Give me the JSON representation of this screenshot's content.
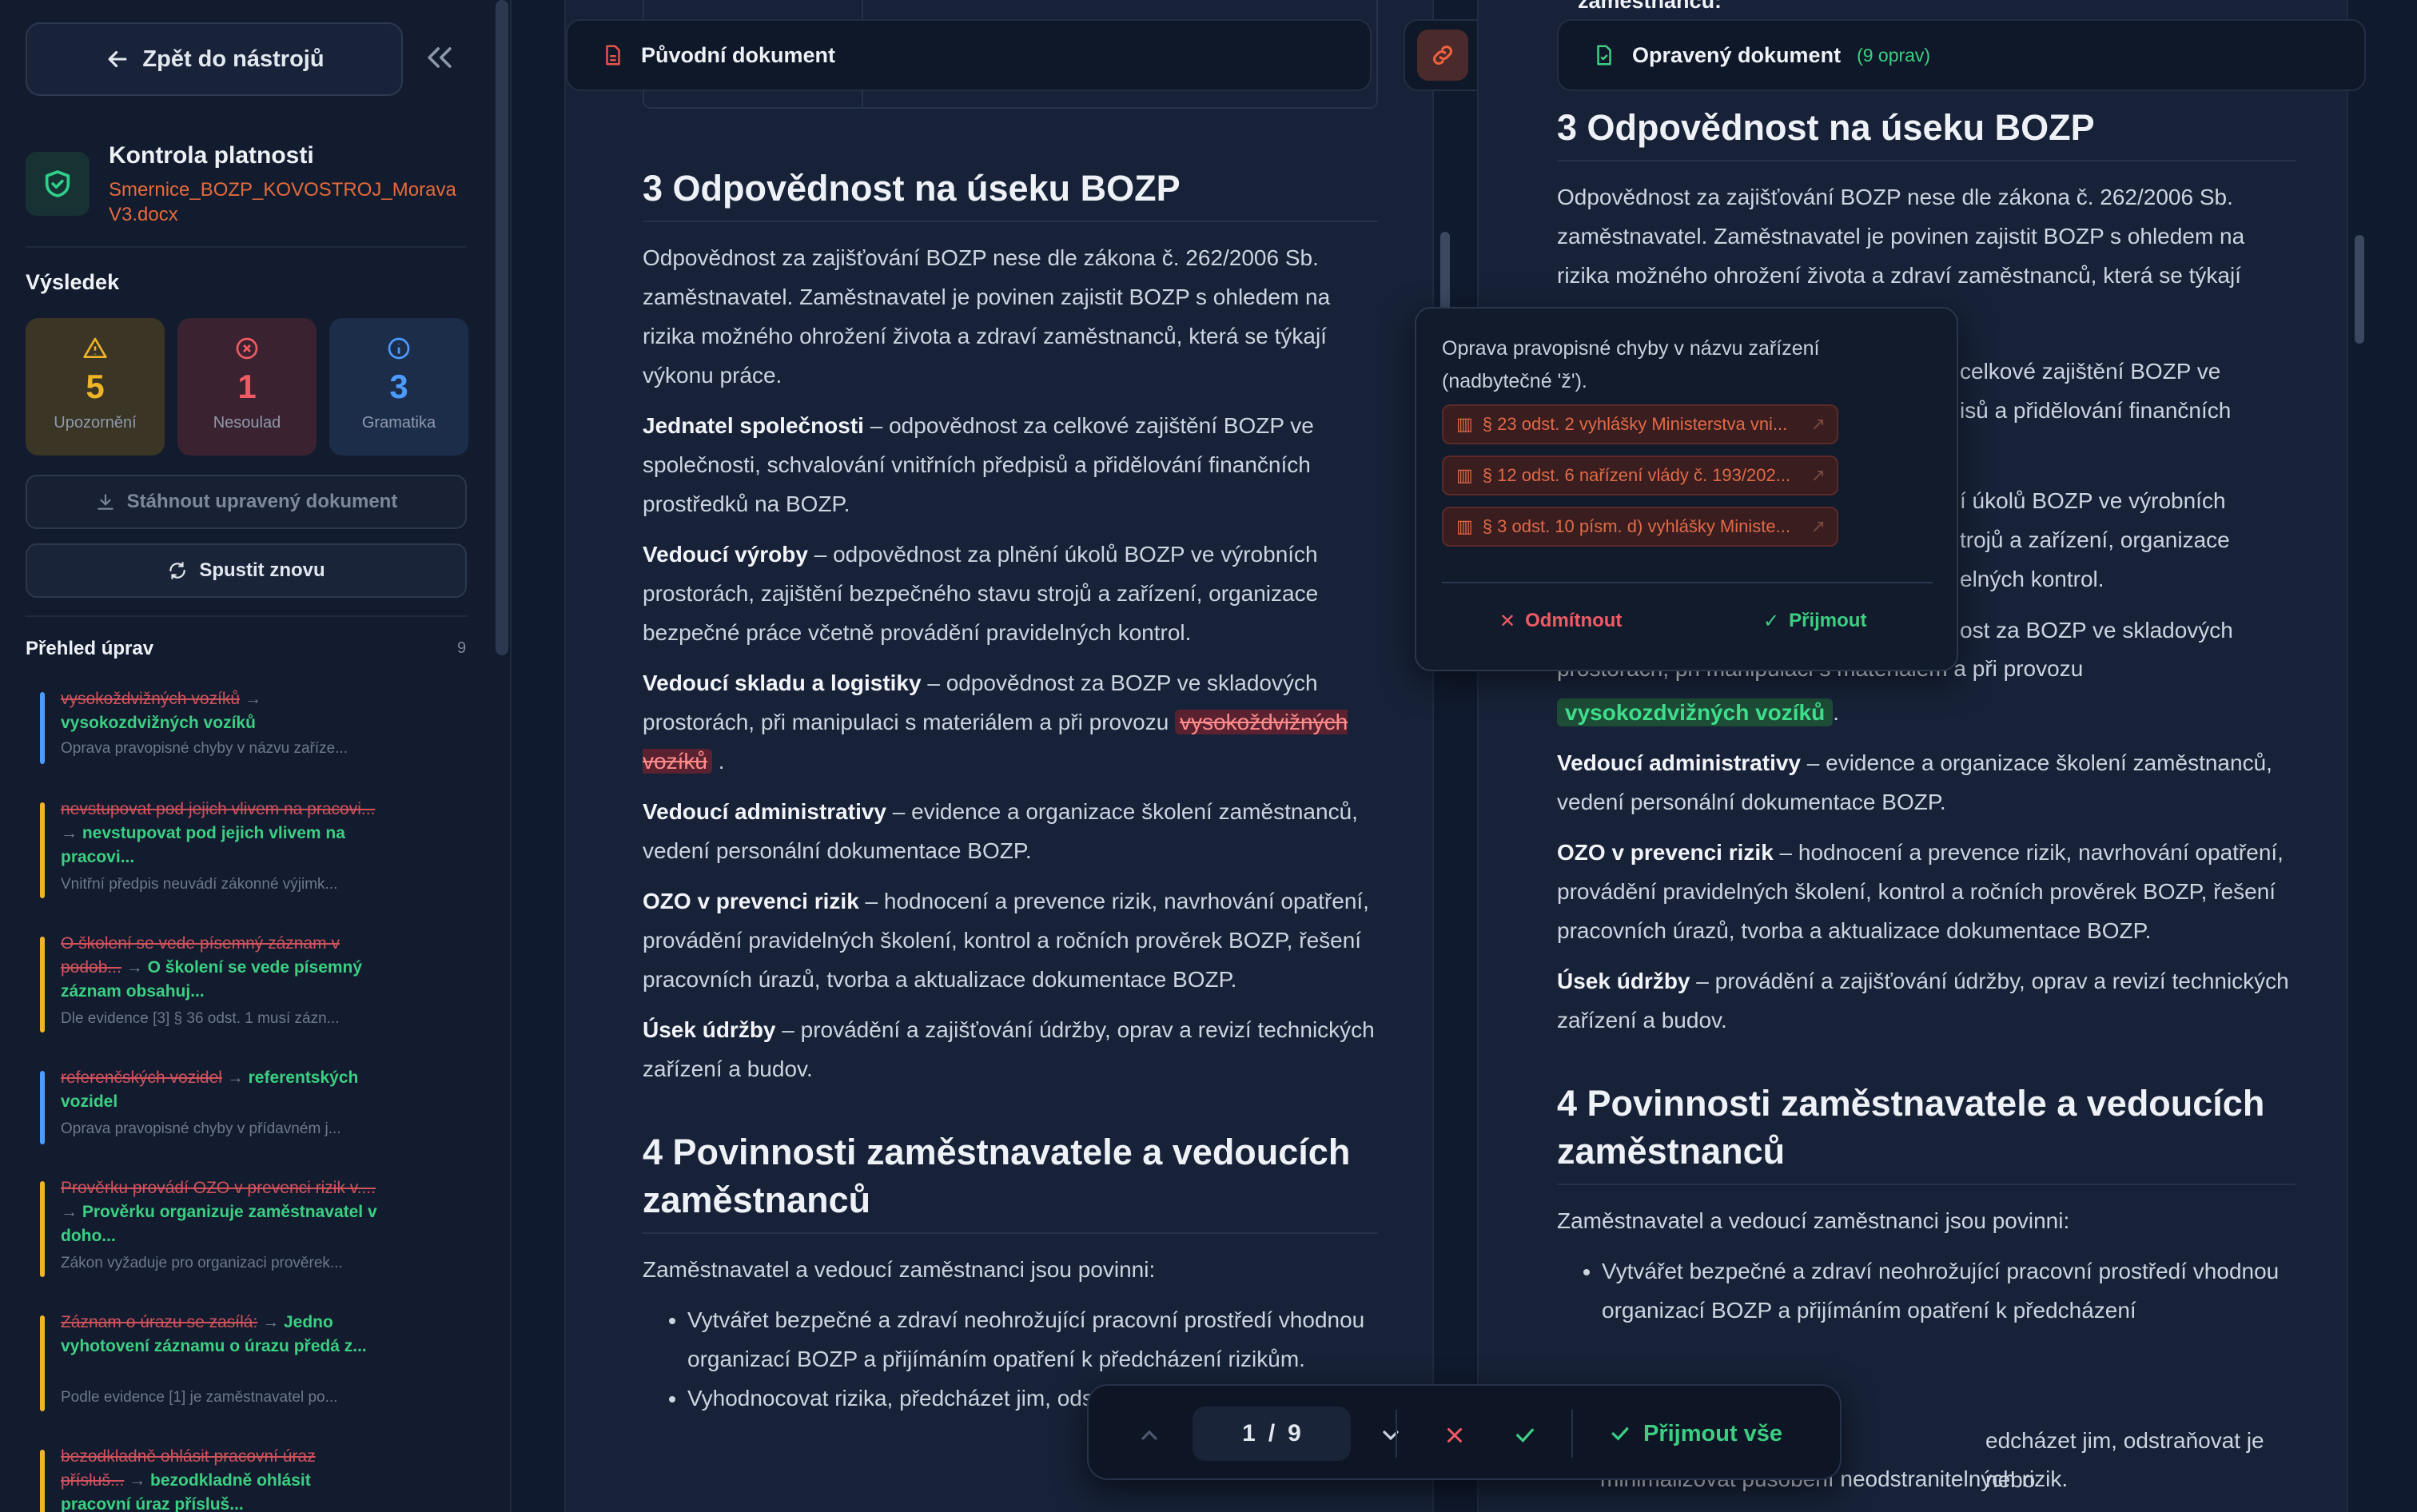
{
  "sidebar": {
    "back_label": "Zpět do nástrojů",
    "title": "Kontrola platnosti",
    "filename": "Smernice_BOZP_KOVOSTROJ_Morava V3.docx",
    "result_heading": "Výsledek",
    "stats": [
      {
        "value": "5",
        "label": "Upozornění",
        "color": "#f0b429"
      },
      {
        "value": "1",
        "label": "Nesoulad",
        "color": "#ef5b65"
      },
      {
        "value": "3",
        "label": "Gramatika",
        "color": "#4c9bff"
      }
    ],
    "download_label": "Stáhnout upravený dokument",
    "rerun_label": "Spustit znovu",
    "overview_heading": "Přehled úprav",
    "overview_count": "9",
    "edits": [
      {
        "old": "vysokoždvižných vozíků",
        "new": "vysokozdvižných vozíků",
        "note": "Oprava pravopisné chyby v názvu zaříze...",
        "color": "#4c9bff"
      },
      {
        "old": "nevstupovat pod jejich vlivem na pracovi...",
        "new": "nevstupovat pod jejich vlivem na pracovi...",
        "note": "Vnitřní předpis neuvádí zákonné výjimk...",
        "color": "#f0b429"
      },
      {
        "old": "O školení se vede písemný záznam v podob...",
        "new": "O školení se vede písemný záznam obsahuj...",
        "note": "Dle evidence [3] § 36 odst. 1 musí zázn...",
        "color": "#f0b429"
      },
      {
        "old": "referenčských vozidel",
        "new": "referentských vozidel",
        "note": "Oprava pravopisné chyby v přídavném j...",
        "color": "#4c9bff"
      },
      {
        "old": "Prověrku provádí OZO v prevenci rizik v....",
        "new": "Prověrku organizuje zaměstnavatel v doho...",
        "note": "Zákon vyžaduje pro organizaci prověrek...",
        "color": "#f0b429"
      },
      {
        "old": "Záznam o úrazu se zasílá:",
        "new": "Jedno vyhotovení záznamu o úrazu předá z...",
        "note": "Podle evidence [1] je zaměstnavatel po...",
        "color": "#f0b429"
      },
      {
        "old": "bezodkladně ohlásit pracovní úraz přísluš...",
        "new": "bezodkladně ohlásit pracovní úraz přísluš...",
        "note": "",
        "color": "#f0b429"
      }
    ]
  },
  "left_doc": {
    "header": "Původní dokument",
    "h_section3": "3 Odpovědnost na úseku BOZP",
    "p_intro": "Odpovědnost za zajišťování BOZP nese dle zákona č. 262/2006 Sb. zaměstnavatel. Zaměstnavatel je povinen zajistit BOZP s ohledem na rizika možného ohrožení života a zdraví zaměstnanců, která se týkají výkonu práce.",
    "jednatel_b": "Jednatel společnosti",
    "jednatel_t": " – odpovědnost za celkové zajištění BOZP ve společnosti, schvalování vnitřních předpisů a přidělování finančních prostředků na BOZP.",
    "vyroba_b": "Vedoucí výroby",
    "vyroba_t": " – odpovědnost za plnění úkolů BOZP ve výrobních prostorách, zajištění bezpečného stavu strojů a zařízení, organizace bezpečné práce včetně provádění pravidelných kontrol.",
    "sklad_b": "Vedoucí skladu a logistiky",
    "sklad_t": " – odpovědnost za BOZP ve skladových prostorách, při manipulaci s materiálem a při provozu ",
    "sklad_old": "vysokoždvižných vozíků",
    "admin_b": "Vedoucí administrativy",
    "admin_t": " – evidence a organizace školení zaměstnanců, vedení personální dokumentace BOZP.",
    "ozo_b": "OZO v prevenci rizik",
    "ozo_t": " – hodnocení a prevence rizik, navrhování opatření, provádění pravidelných školení, kontrol a ročních prověrek BOZP, řešení pracovních úrazů, tvorba a aktualizace dokumentace BOZP.",
    "udrzba_b": "Úsek údržby",
    "udrzba_t": " – provádění a zajišťování údržby, oprav a revizí technických zařízení a budov.",
    "h_section4": "4 Povinnosti zaměstnavatele a vedoucích zaměstnanců",
    "p_duties": "Zaměstnavatel a vedoucí zaměstnanci jsou povinni:",
    "li1": "Vytvářet bezpečné a zdraví neohrožující pracovní prostředí vhodnou organizací BOZP a přijímáním opatření k předcházení rizikům.",
    "li2": "Vyhodnocovat rizika, předcházet jim, odstraňovat je nebo"
  },
  "right_doc": {
    "header": "Opravený dokument",
    "count": "(9 oprav)",
    "top_fragment": "zaměstnanců:",
    "h_section3": "3 Odpovědnost na úseku BOZP",
    "p_intro": "Odpovědnost za zajišťování BOZP nese dle zákona č. 262/2006 Sb. zaměstnavatel. Zaměstnavatel je povinen zajistit BOZP s ohledem na rizika možného ohrožení života a zdraví zaměstnanců, která se týkají",
    "frag1a": "celkové zajištění BOZP ve",
    "frag1b": "isů a přidělování finančních",
    "frag2a": "í úkolů BOZP ve výrobních",
    "frag2b": "trojů a zařízení, organizace",
    "frag2c": "elných kontrol.",
    "frag3a": "ost za BOZP ve skladových",
    "frag3b": "prostorách, při manipulaci s materiálem a při provozu",
    "sklad_new": "vysokozdvižných vozíků",
    "admin_b": "Vedoucí administrativy",
    "admin_t": " – evidence a organizace školení zaměstnanců, vedení personální dokumentace BOZP.",
    "ozo_b": "OZO v prevenci rizik",
    "ozo_t": " – hodnocení a prevence rizik, navrhování opatření, provádění pravidelných školení, kontrol a ročních prověrek BOZP, řešení pracovních úrazů, tvorba a aktualizace dokumentace BOZP.",
    "udrzba_b": "Úsek údržby",
    "udrzba_t": " – provádění a zajišťování údržby, oprav a revizí technických zařízení a budov.",
    "h_section4": "4 Povinnosti zaměstnavatele a vedoucích zaměstnanců",
    "p_duties": "Zaměstnavatel a vedoucí zaměstnanci jsou povinni:",
    "li1": "Vytvářet bezpečné a zdraví neohrožující pracovní prostředí vhodnou organizací BOZP a přijímáním opatření k předcházení",
    "li2a": "edcházet jim, odstraňovat je nebo",
    "li2b": "minimalizovat působení neodstranitelných rizik."
  },
  "popover": {
    "text": "Oprava pravopisné chyby v názvu zařízení (nadbytečné 'ž').",
    "refs": [
      "§ 23 odst. 2 vyhlášky Ministerstva vni...",
      "§ 12 odst. 6 nařízení vlády č. 193/202...",
      "§ 3 odst. 10 písm. d) vyhlášky Ministe..."
    ],
    "reject": "Odmítnout",
    "accept": "Přijmout"
  },
  "bottom_bar": {
    "current": "1",
    "separator": "/",
    "total": "9",
    "accept_all": "Přijmout vše"
  }
}
